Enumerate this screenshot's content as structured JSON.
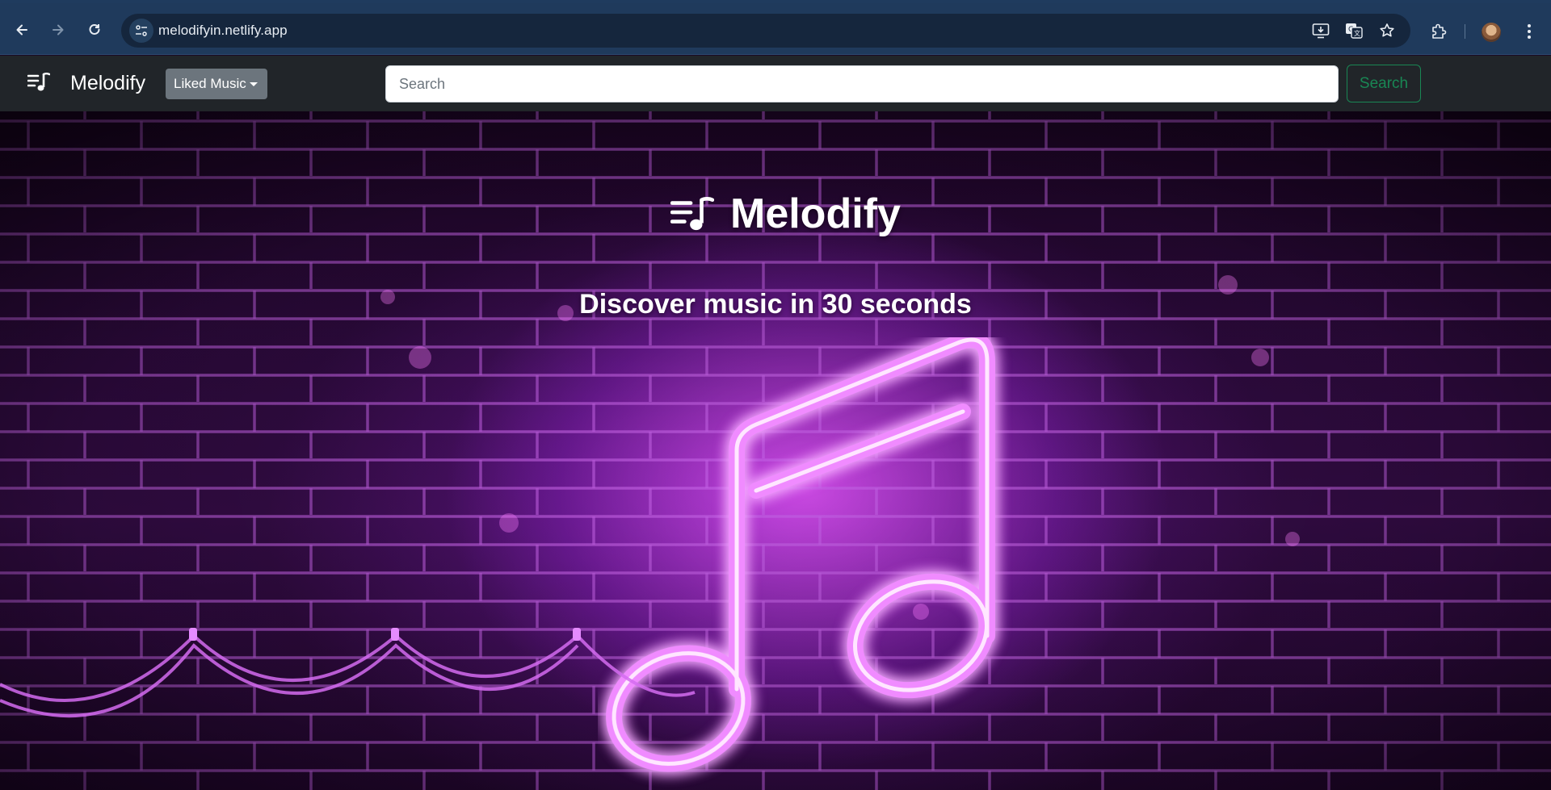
{
  "browser": {
    "url": "melodifyin.netlify.app",
    "icons": {
      "back": "back-arrow-icon",
      "forward": "forward-arrow-icon",
      "reload": "reload-icon",
      "site_settings": "tune-icon",
      "install": "install-app-icon",
      "translate": "translate-icon",
      "bookmark": "star-icon",
      "extensions": "puzzle-icon",
      "profile": "avatar",
      "menu": "kebab-menu-icon"
    }
  },
  "navbar": {
    "brand": "Melodify",
    "liked_label": "Liked Music",
    "search_placeholder": "Search",
    "search_value": "",
    "search_button": "Search",
    "colors": {
      "background": "#212529",
      "dropdown": "#6c757d",
      "search_button": "#198754"
    }
  },
  "hero": {
    "title": "Melodify",
    "subtitle": "Discover music in 30 seconds",
    "colors": {
      "neon": "#f08bff",
      "wall": "#3a0d4e"
    }
  }
}
